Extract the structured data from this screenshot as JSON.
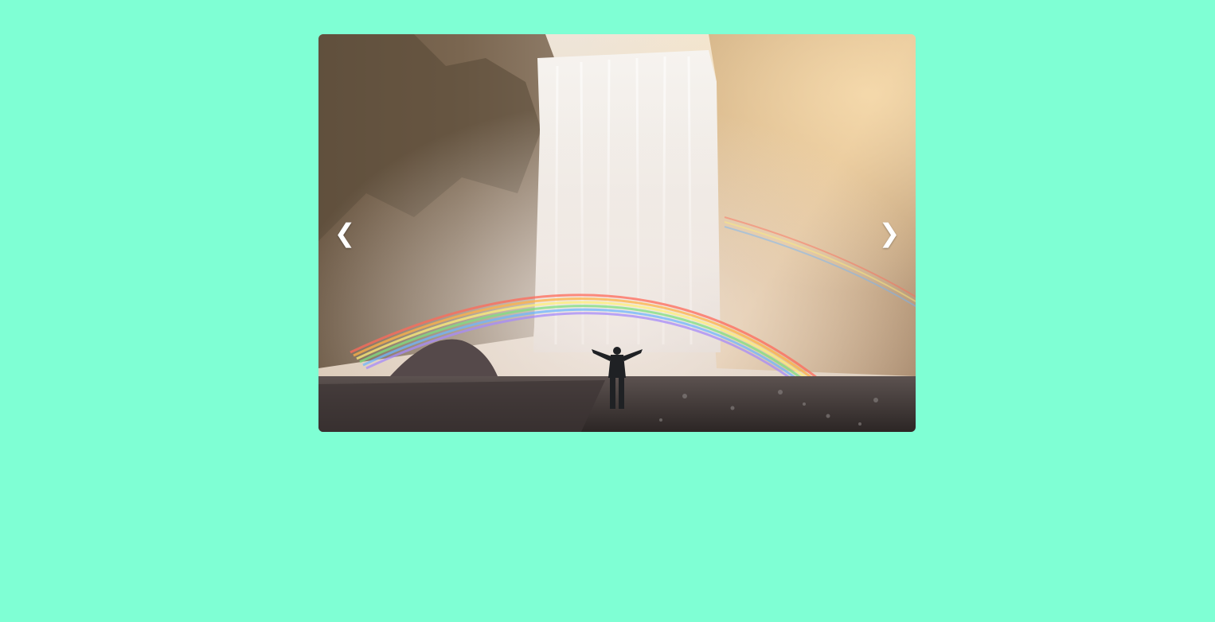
{
  "page": {
    "background_color": "#7fffd4"
  },
  "carousel": {
    "slide_image": {
      "subject": "waterfall-with-rainbow-and-person",
      "icon": "photo-image"
    },
    "prev_button": {
      "label": "❮",
      "icon": "chevron-left-icon"
    },
    "next_button": {
      "label": "❯",
      "icon": "chevron-right-icon"
    }
  }
}
